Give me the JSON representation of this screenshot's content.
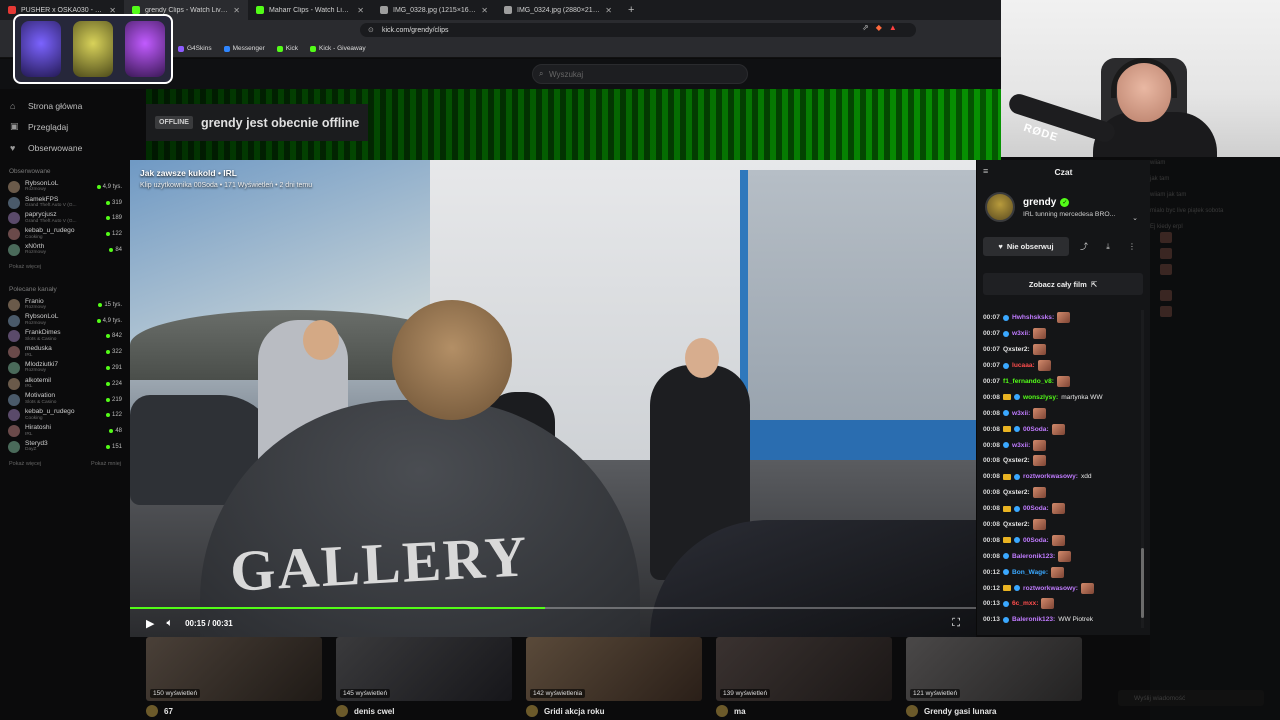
{
  "browser": {
    "tabs": [
      {
        "title": "PUSHER x OSKA030 - GZMN (prod. ...",
        "color": "#e53935",
        "active": false
      },
      {
        "title": "grendy Clips - Watch Live on Kick",
        "color": "#53fc18",
        "active": true
      },
      {
        "title": "Maharr Clips - Watch Live on Kick",
        "color": "#53fc18",
        "active": false
      },
      {
        "title": "IMG_0328.jpg (1215×1620)",
        "color": "#9e9e9e",
        "active": false
      },
      {
        "title": "IMG_0324.jpg (2880×2160)",
        "color": "#9e9e9e",
        "active": false
      }
    ],
    "new_tab": "+",
    "url": "kick.com/grendy/clips",
    "bookmarks": [
      {
        "label": "G4Skins",
        "color": "#8e5cff"
      },
      {
        "label": "Messenger",
        "color": "#2f86ff"
      },
      {
        "label": "Kick",
        "color": "#53fc18"
      },
      {
        "label": "Kick - Giveaway",
        "color": "#53fc18"
      }
    ]
  },
  "kick": {
    "search_placeholder": "Wyszukaj",
    "nav": [
      {
        "label": "Strona główna",
        "icon": "home-icon"
      },
      {
        "label": "Przeglądaj",
        "icon": "browse-icon"
      },
      {
        "label": "Obserwowane",
        "icon": "heart-icon"
      }
    ],
    "followed_title": "Obserwowane",
    "followed": [
      {
        "name": "RybsonLoL",
        "cat": "Rozmowy",
        "viewers": "4,9 tys."
      },
      {
        "name": "SamekFPS",
        "cat": "Grand Theft Auto V (G...",
        "viewers": "319"
      },
      {
        "name": "paprycjusz",
        "cat": "Grand Theft Auto V (G...",
        "viewers": "189"
      },
      {
        "name": "kebab_u_rudego",
        "cat": "Cooking",
        "viewers": "122"
      },
      {
        "name": "xN0rth",
        "cat": "Rozmowy",
        "viewers": "84"
      }
    ],
    "show_more": "Pokaż więcej",
    "recommended_title": "Polecane kanały",
    "recommended": [
      {
        "name": "Franio",
        "cat": "Rozmowy",
        "viewers": "15 tys."
      },
      {
        "name": "RybsonLoL",
        "cat": "Rozmowy",
        "viewers": "4,9 tys."
      },
      {
        "name": "FrankDimes",
        "cat": "Slots & Casino",
        "viewers": "842"
      },
      {
        "name": "meduska",
        "cat": "IRL",
        "viewers": "322"
      },
      {
        "name": "Mlodziutki7",
        "cat": "Rozmowy",
        "viewers": "291"
      },
      {
        "name": "alkotemil",
        "cat": "IRL",
        "viewers": "224"
      },
      {
        "name": "Motivation",
        "cat": "Slots & Casino",
        "viewers": "219"
      },
      {
        "name": "kebab_u_rudego",
        "cat": "Cooking",
        "viewers": "122"
      },
      {
        "name": "Hiratoshi",
        "cat": "IRL",
        "viewers": "48"
      },
      {
        "name": "Steryd3",
        "cat": "DayZ",
        "viewers": "151"
      }
    ],
    "show_more_2": "Pokaż więcej",
    "show_less": "Pokaż mniej",
    "offline_pill": "OFFLINE",
    "offline_text": "grendy jest obecnie offline"
  },
  "video": {
    "title": "Jak zawsze kukold • IRL",
    "subtitle": "Klip użytkownika 00Soda • 171 Wyświetleń • 2 dni temu",
    "time": "00:15 / 00:31",
    "progress": 0.49,
    "shirt_text": "GALLERY"
  },
  "chat": {
    "title": "Czat",
    "streamer": "grendy",
    "category": "IRL tunning mercedesa BRO...",
    "follow_label": "Nie obserwuj",
    "full_film_label": "Zobacz cały film",
    "messages": [
      {
        "t": "00:07",
        "badge": "b",
        "user": "Hwhshsksks",
        "color": "#c07bff",
        "text": "",
        "emote": true
      },
      {
        "t": "00:07",
        "badge": "b",
        "user": "w3xii",
        "color": "#c07bff",
        "text": "",
        "emote": true
      },
      {
        "t": "00:07",
        "badge": "",
        "user": "Qxster2",
        "color": "#e6e6e6",
        "text": "",
        "emote": true
      },
      {
        "t": "00:07",
        "badge": "b",
        "user": "lucaaa",
        "color": "#ff4d4d",
        "text": "",
        "emote": true
      },
      {
        "t": "00:07",
        "badge": "",
        "user": "f1_fernando_v8",
        "color": "#53fc18",
        "text": "",
        "emote": true
      },
      {
        "t": "00:08",
        "badge": "bb",
        "user": "wonszlysy",
        "color": "#53fc18",
        "text": "martynka WW",
        "emote": false
      },
      {
        "t": "00:08",
        "badge": "b",
        "user": "w3xii",
        "color": "#c07bff",
        "text": "",
        "emote": true
      },
      {
        "t": "00:08",
        "badge": "bb",
        "user": "00Soda",
        "color": "#c07bff",
        "text": "",
        "emote": true
      },
      {
        "t": "00:08",
        "badge": "b",
        "user": "w3xii",
        "color": "#c07bff",
        "text": "",
        "emote": true
      },
      {
        "t": "00:08",
        "badge": "",
        "user": "Qxster2",
        "color": "#e6e6e6",
        "text": "",
        "emote": true
      },
      {
        "t": "00:08",
        "badge": "bb",
        "user": "roztworkwasowy",
        "color": "#c07bff",
        "text": "xdd",
        "emote": false
      },
      {
        "t": "00:08",
        "badge": "",
        "user": "Qxster2",
        "color": "#e6e6e6",
        "text": "",
        "emote": true
      },
      {
        "t": "00:08",
        "badge": "bb",
        "user": "00Soda",
        "color": "#c07bff",
        "text": "",
        "emote": true
      },
      {
        "t": "00:08",
        "badge": "",
        "user": "Qxster2",
        "color": "#e6e6e6",
        "text": "",
        "emote": true
      },
      {
        "t": "00:08",
        "badge": "bb",
        "user": "00Soda",
        "color": "#c07bff",
        "text": "",
        "emote": true
      },
      {
        "t": "00:08",
        "badge": "b",
        "user": "Baleronik123",
        "color": "#c07bff",
        "text": "",
        "emote": true
      },
      {
        "t": "00:12",
        "badge": "b",
        "user": "Bon_Wage",
        "color": "#3aa8ff",
        "text": "",
        "emote": true
      },
      {
        "t": "00:12",
        "badge": "bb",
        "user": "roztworkwasowy",
        "color": "#c07bff",
        "text": "",
        "emote": true
      },
      {
        "t": "00:13",
        "badge": "b",
        "user": "6c_mxx",
        "color": "#ff4d4d",
        "text": "",
        "emote": true
      },
      {
        "t": "00:13",
        "badge": "b",
        "user": "Baleronik123",
        "color": "#c07bff",
        "text": "WW Piotrek",
        "emote": false
      }
    ]
  },
  "clips": [
    {
      "views": "150 wyświetleń",
      "title": "67"
    },
    {
      "views": "145 wyświetleń",
      "title": "denis cwel"
    },
    {
      "views": "142 wyświetlenia",
      "title": "Gridi akcja roku"
    },
    {
      "views": "139 wyświetleń",
      "title": "ma"
    },
    {
      "views": "121 wyświetleń",
      "title": "Grendy gasi lunara"
    }
  ],
  "webcam": {
    "mic_brand": "RØDE"
  },
  "ghost_chat": {
    "lines": [
      "wiiam",
      "jak tam",
      "wiiam jak tam",
      "mialo byc live piątek sobota",
      "Ej kiedy erpl"
    ],
    "input_placeholder": "Wyślij wiadomość"
  },
  "colors": {
    "accent": "#53fc18",
    "bg": "#0b0b0c",
    "panel": "#141517"
  }
}
